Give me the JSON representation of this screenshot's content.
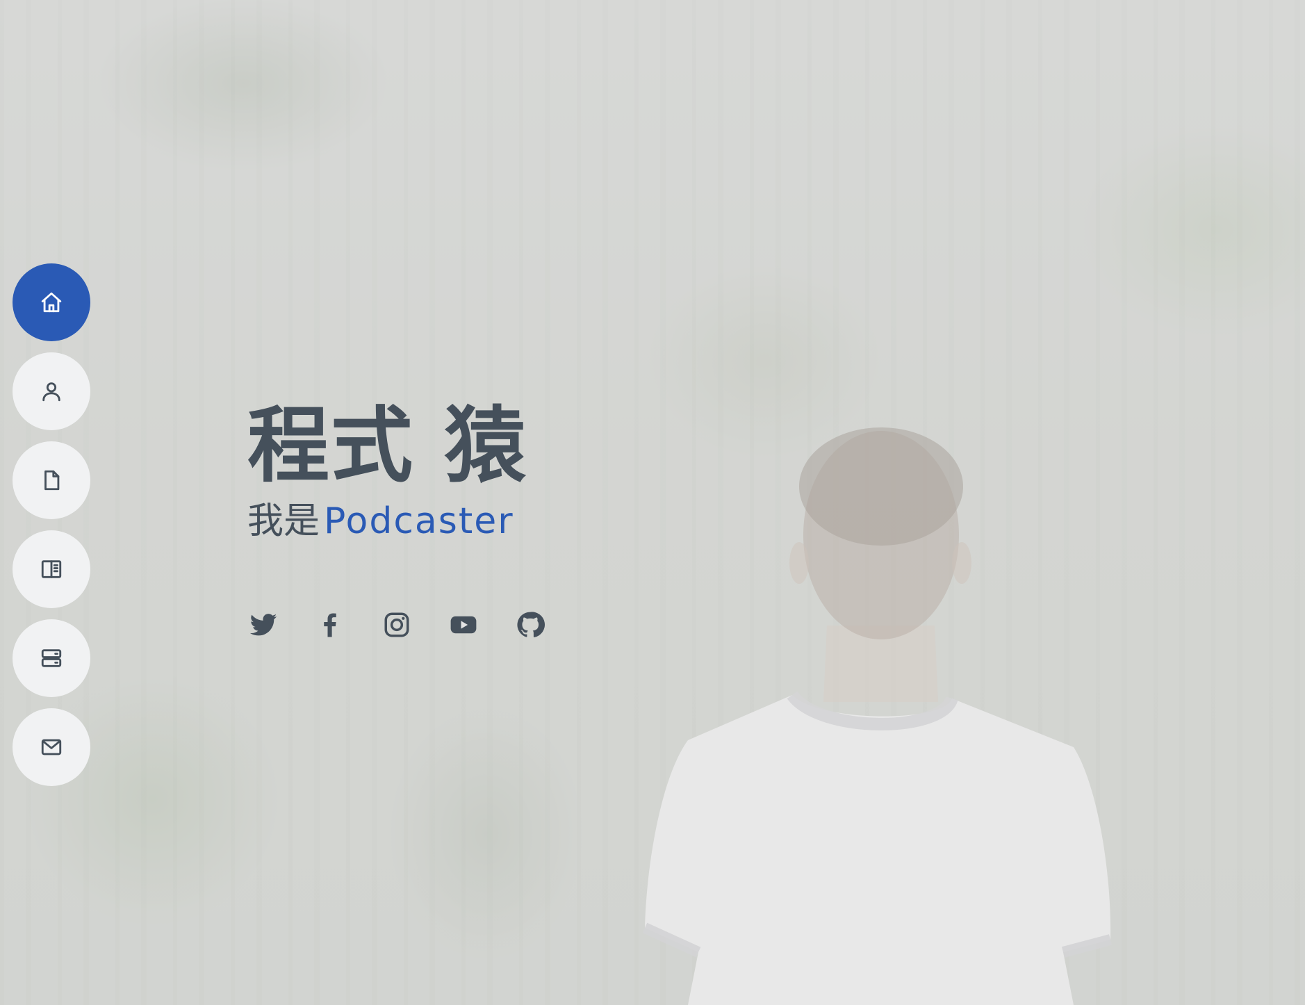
{
  "hero": {
    "title": "程式 猿",
    "subtitle_prefix": "我是",
    "subtitle_role": "Podcaster"
  },
  "nav": {
    "items": [
      {
        "id": "home",
        "icon": "home-icon",
        "active": true
      },
      {
        "id": "about",
        "icon": "person-icon",
        "active": false
      },
      {
        "id": "resume",
        "icon": "file-icon",
        "active": false
      },
      {
        "id": "portfolio",
        "icon": "book-half-icon",
        "active": false
      },
      {
        "id": "services",
        "icon": "server-icon",
        "active": false
      },
      {
        "id": "contact",
        "icon": "envelope-icon",
        "active": false
      }
    ]
  },
  "social": {
    "links": [
      {
        "id": "twitter",
        "icon": "twitter-icon"
      },
      {
        "id": "facebook",
        "icon": "facebook-icon"
      },
      {
        "id": "instagram",
        "icon": "instagram-icon"
      },
      {
        "id": "youtube",
        "icon": "youtube-icon"
      },
      {
        "id": "github",
        "icon": "github-icon"
      }
    ]
  },
  "colors": {
    "accent": "#2a5ab5",
    "text": "#45505b",
    "nav_bg": "#f1f2f3",
    "page_bg": "#d6d7d6"
  }
}
